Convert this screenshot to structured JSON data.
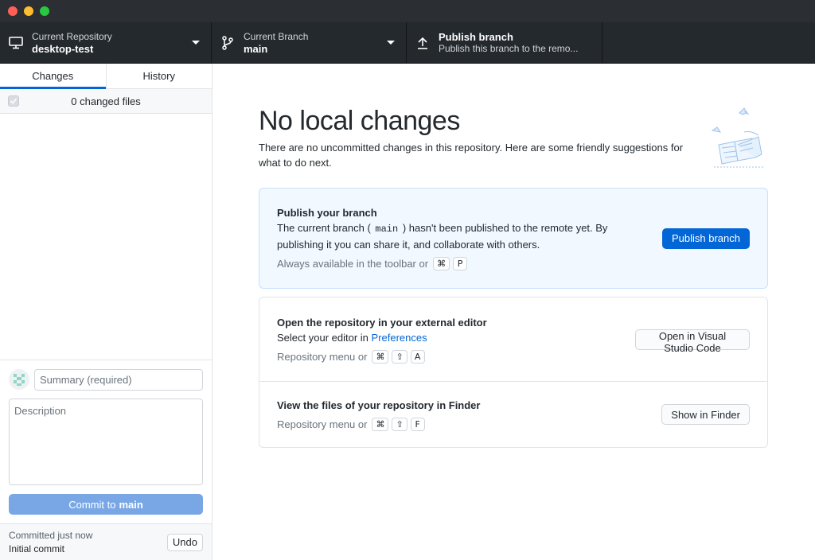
{
  "toolbar": {
    "repository": {
      "label": "Current Repository",
      "value": "desktop-test"
    },
    "branch": {
      "label": "Current Branch",
      "value": "main"
    },
    "publish": {
      "title": "Publish branch",
      "subtitle": "Publish this branch to the remo..."
    }
  },
  "sidebar": {
    "tabs": [
      {
        "label": "Changes"
      },
      {
        "label": "History"
      }
    ],
    "changed_files": "0 changed files",
    "summary_placeholder": "Summary (required)",
    "description_placeholder": "Description",
    "commit_prefix": "Commit to",
    "commit_branch": "main",
    "last_commit": {
      "label": "Committed just now",
      "title": "Initial commit",
      "undo": "Undo"
    }
  },
  "main": {
    "title": "No local changes",
    "description": "There are no uncommitted changes in this repository. Here are some friendly suggestions for what to do next.",
    "publish_card": {
      "title": "Publish your branch",
      "desc_before": "The current branch (",
      "desc_branch": "main",
      "desc_after": ") hasn't been published to the remote yet. By publishing it you can share it, and collaborate with others.",
      "shortcut_text": "Always available in the toolbar or",
      "keys": [
        "⌘",
        "P"
      ],
      "button": "Publish branch"
    },
    "editor_card": {
      "title": "Open the repository in your external editor",
      "desc_before": "Select your editor in",
      "desc_link": "Preferences",
      "shortcut_text": "Repository menu or",
      "keys": [
        "⌘",
        "⇧",
        "A"
      ],
      "button": "Open in Visual Studio Code"
    },
    "finder_card": {
      "title": "View the files of your repository in Finder",
      "shortcut_text": "Repository menu or",
      "keys": [
        "⌘",
        "⇧",
        "F"
      ],
      "button": "Show in Finder"
    }
  },
  "colors": {
    "accent": "#0366d6",
    "toolbar_bg": "#24292e",
    "commit_button": "#79a7e6",
    "publish_card_bg": "#f1f8ff"
  }
}
